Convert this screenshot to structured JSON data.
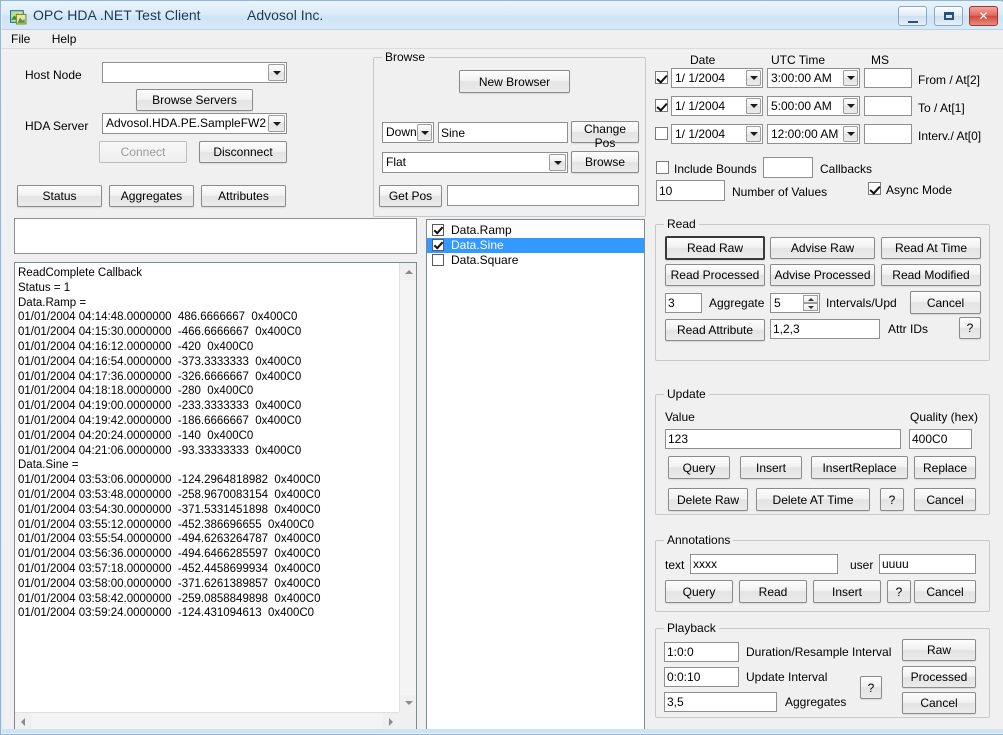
{
  "window": {
    "title": "OPC HDA .NET Test Client",
    "subtitle": "Advosol Inc.",
    "minimize_label": "Minimize",
    "maximize_label": "Maximize",
    "close_label": "✕"
  },
  "menu": {
    "items": [
      {
        "label": "File"
      },
      {
        "label": "Help"
      }
    ]
  },
  "connection": {
    "host_node_label": "Host Node",
    "host_node_value": "",
    "browse_servers_label": "Browse Servers",
    "hda_server_label": "HDA Server",
    "hda_server_value": "Advosol.HDA.PE.SampleFW2",
    "connect_label": "Connect",
    "disconnect_label": "Disconnect",
    "status_label": "Status",
    "aggregates_label": "Aggregates",
    "attributes_label": "Attributes"
  },
  "browse": {
    "title": "Browse",
    "new_browser_label": "New Browser",
    "direction_value": "Down",
    "path_value": "Sine",
    "change_pos_label": "Change Pos",
    "filter_value": "Flat",
    "browse_label": "Browse",
    "get_pos_label": "Get Pos",
    "get_pos_value": ""
  },
  "time": {
    "date_header": "Date",
    "utc_time_header": "UTC  Time",
    "ms_header": "MS",
    "rows": [
      {
        "checked": true,
        "date": "1/  1/2004",
        "time": "3:00:00 AM",
        "ms": "",
        "label": "From  / At[2]"
      },
      {
        "checked": true,
        "date": "1/  1/2004",
        "time": "5:00:00 AM",
        "ms": "",
        "label": "To    / At[1]"
      },
      {
        "checked": false,
        "date": "1/  1/2004",
        "time": "12:00:00 AM",
        "ms": "",
        "label": "Interv./ At[0]"
      }
    ],
    "include_bounds_label": "Include Bounds",
    "include_bounds_checked": false,
    "callbacks_label": "Callbacks",
    "callbacks_value": "",
    "number_of_values_value": "10",
    "number_of_values_label": "Number of Values",
    "async_mode_label": "Async Mode",
    "async_mode_checked": true
  },
  "log": {
    "input_value": "",
    "text": "ReadComplete Callback\nStatus = 1\nData.Ramp =\n01/01/2004 04:14:48.0000000  486.6666667  0x400C0\n01/01/2004 04:15:30.0000000  -466.6666667  0x400C0\n01/01/2004 04:16:12.0000000  -420  0x400C0\n01/01/2004 04:16:54.0000000  -373.3333333  0x400C0\n01/01/2004 04:17:36.0000000  -326.6666667  0x400C0\n01/01/2004 04:18:18.0000000  -280  0x400C0\n01/01/2004 04:19:00.0000000  -233.3333333  0x400C0\n01/01/2004 04:19:42.0000000  -186.6666667  0x400C0\n01/01/2004 04:20:24.0000000  -140  0x400C0\n01/01/2004 04:21:06.0000000  -93.33333333  0x400C0\nData.Sine =\n01/01/2004 03:53:06.0000000  -124.2964818982  0x400C0\n01/01/2004 03:53:48.0000000  -258.9670083154  0x400C0\n01/01/2004 03:54:30.0000000  -371.5331451898  0x400C0\n01/01/2004 03:55:12.0000000  -452.386696655  0x400C0\n01/01/2004 03:55:54.0000000  -494.6263264787  0x400C0\n01/01/2004 03:56:36.0000000  -494.6466285597  0x400C0\n01/01/2004 03:57:18.0000000  -452.4458699934  0x400C0\n01/01/2004 03:58:00.0000000  -371.6261389857  0x400C0\n01/01/2004 03:58:42.0000000  -259.0858849898  0x400C0\n01/01/2004 03:59:24.0000000  -124.431094613  0x400C0"
  },
  "items": {
    "list": [
      {
        "label": "Data.Ramp",
        "checked": true,
        "selected": false
      },
      {
        "label": "Data.Sine",
        "checked": true,
        "selected": true
      },
      {
        "label": "Data.Square",
        "checked": false,
        "selected": false
      }
    ]
  },
  "read": {
    "title": "Read",
    "read_raw_label": "Read Raw",
    "advise_raw_label": "Advise Raw",
    "read_at_time_label": "Read At Time",
    "read_processed_label": "Read Processed",
    "advise_processed_label": "Advise Processed",
    "read_modified_label": "Read Modified",
    "aggregate_value": "3",
    "aggregate_label": "Aggregate",
    "intervals_value": "5",
    "intervals_label": "Intervals/Upd",
    "cancel_label": "Cancel",
    "read_attribute_label": "Read Attribute",
    "attr_ids_value": "1,2,3",
    "attr_ids_label": "Attr IDs",
    "help_label": "?"
  },
  "update": {
    "title": "Update",
    "value_label": "Value",
    "value_value": "123",
    "quality_label": "Quality (hex)",
    "quality_value": "400C0",
    "query_label": "Query",
    "insert_label": "Insert",
    "insert_replace_label": "InsertReplace",
    "replace_label": "Replace",
    "delete_raw_label": "Delete Raw",
    "delete_at_time_label": "Delete AT Time",
    "help_label": "?",
    "cancel_label": "Cancel"
  },
  "annotations": {
    "title": "Annotations",
    "text_label": "text",
    "text_value": "xxxx",
    "user_label": "user",
    "user_value": "uuuu",
    "query_label": "Query",
    "read_label": "Read",
    "insert_label": "Insert",
    "help_label": "?",
    "cancel_label": "Cancel"
  },
  "playback": {
    "title": "Playback",
    "duration_value": "1:0:0",
    "duration_label": "Duration/Resample Interval",
    "update_value": "0:0:10",
    "update_label": "Update Interval",
    "aggregates_value": "3,5",
    "aggregates_label": "Aggregates",
    "help_label": "?",
    "raw_label": "Raw",
    "processed_label": "Processed",
    "cancel_label": "Cancel"
  }
}
